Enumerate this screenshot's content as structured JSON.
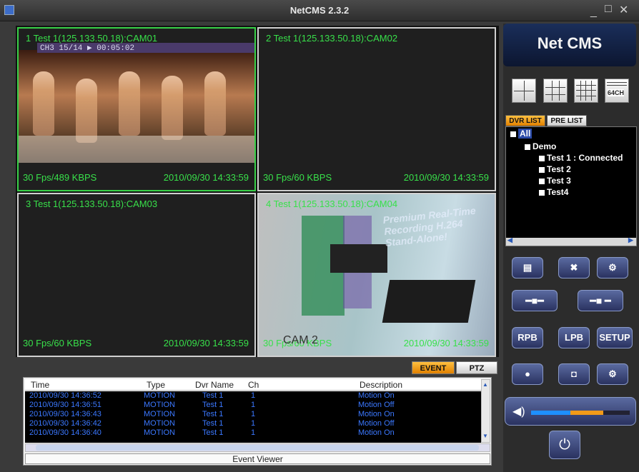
{
  "window": {
    "title": "NetCMS 2.3.2",
    "min": "_",
    "max": "□",
    "close": "✕"
  },
  "colors": {
    "osd_green": "#38e04a",
    "event_blue": "#3b78ff",
    "tab_active": "#f0a020",
    "brand_bg": "#1a2e5a"
  },
  "cameras": [
    {
      "label": "1 Test 1(125.133.50.18):CAM01",
      "fps": "30 Fps/489 KBPS",
      "timestamp": "2010/09/30 14:33:59",
      "selected": true,
      "osd": "CH3  15/14  ▶  00:05:02"
    },
    {
      "label": "2 Test 1(125.133.50.18):CAM02",
      "fps": "30 Fps/60 KBPS",
      "timestamp": "2010/09/30 14:33:59",
      "selected": false
    },
    {
      "label": "3 Test 1(125.133.50.18):CAM03",
      "fps": "30 Fps/60 KBPS",
      "timestamp": "2010/09/30 14:33:59",
      "selected": false
    },
    {
      "label": "4 Test 1(125.133.50.18):CAM04",
      "fps": "30 Fps/60 KBPS",
      "timestamp": "2010/09/30 14:33:59",
      "selected": false,
      "overlay": "CAM 2",
      "banner": "Premium Real-Time Recording H.264 Stand-Alone!"
    }
  ],
  "event_tabs": {
    "event": "EVENT",
    "ptz": "PTZ"
  },
  "event_viewer": {
    "columns": [
      "Time",
      "Type",
      "Dvr Name",
      "Ch",
      "Description"
    ],
    "rows": [
      [
        "2010/09/30 14:36:52",
        "MOTION",
        "Test 1",
        "1",
        "Motion On"
      ],
      [
        "2010/09/30 14:36:51",
        "MOTION",
        "Test 1",
        "1",
        "Motion Off"
      ],
      [
        "2010/09/30 14:36:43",
        "MOTION",
        "Test 1",
        "1",
        "Motion On"
      ],
      [
        "2010/09/30 14:36:42",
        "MOTION",
        "Test 1",
        "1",
        "Motion Off"
      ],
      [
        "2010/09/30 14:36:40",
        "MOTION",
        "Test 1",
        "1",
        "Motion On"
      ]
    ],
    "footer": "Event Viewer"
  },
  "side": {
    "brand": "Net CMS",
    "layout_64ch_label": "64CH",
    "tabs": {
      "dvr_list": "DVR LIST",
      "pre_list": "PRE LIST"
    },
    "tree": {
      "all": "All",
      "group": "Demo",
      "items": [
        "Test 1 : Connected",
        "Test 2",
        "Test 3",
        "Test4"
      ]
    },
    "buttons": {
      "rpb": "RPB",
      "lpb": "LPB",
      "setup": "SETUP"
    },
    "volume_level": 0.73
  }
}
